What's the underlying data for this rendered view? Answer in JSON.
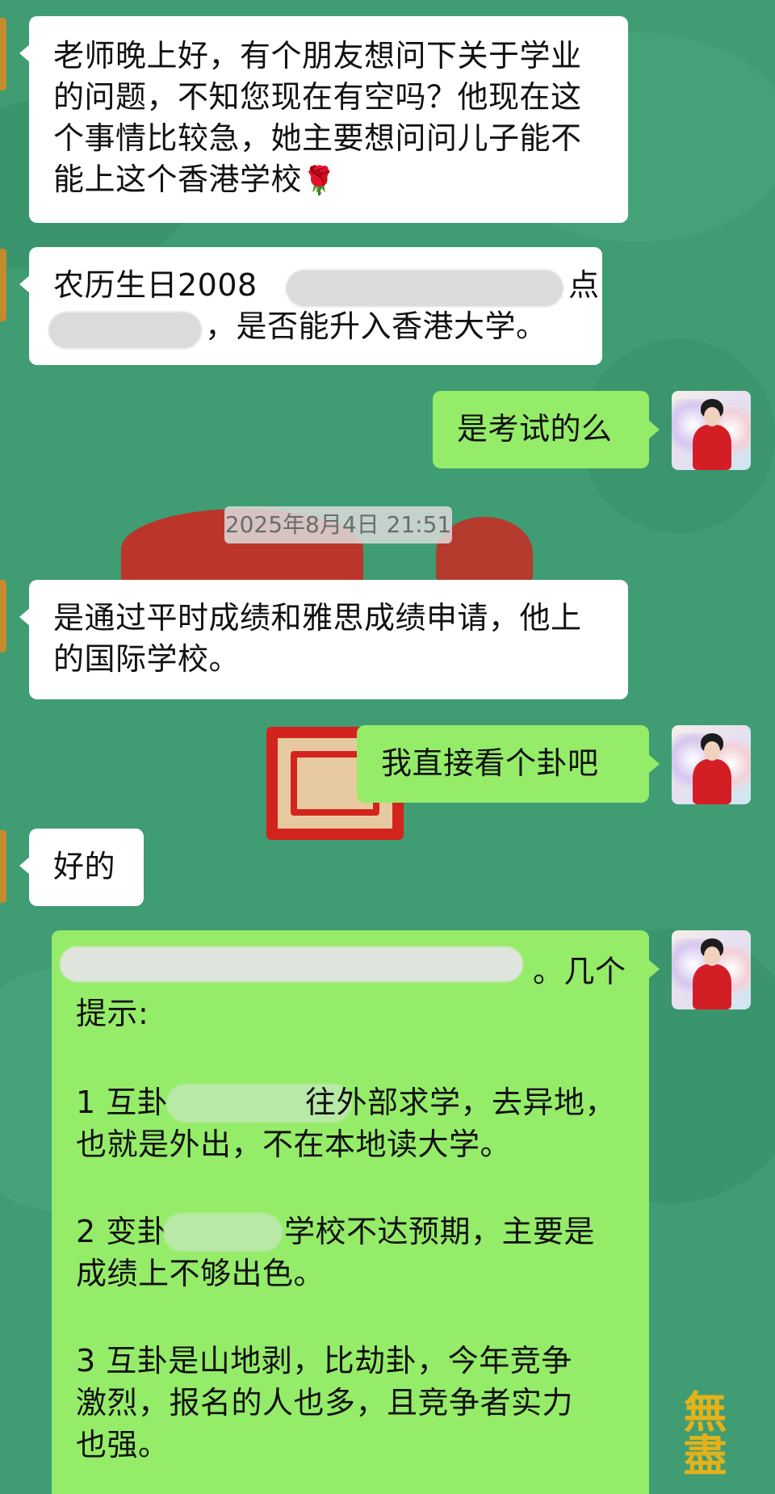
{
  "chat": {
    "timestamp": "2025年8月4日 21:51",
    "messages": [
      {
        "side": "left",
        "text": "老师晚上好，有个朋友想问下关于学业的问题，不知您现在有空吗？他现在这个事情比较急，她主要想问问儿子能不能上这个香港学校",
        "emoji": "🌹"
      },
      {
        "side": "left",
        "line1": "农历生日2008",
        "line1_end": "点",
        "line2": "，是否能升入香港大学。"
      },
      {
        "side": "right",
        "text": "是考试的么"
      },
      {
        "side": "left",
        "text": "是通过平时成绩和雅思成绩申请，他上的国际学校。"
      },
      {
        "side": "right",
        "text": "我直接看个卦吧"
      },
      {
        "side": "left",
        "text": "好的"
      },
      {
        "side": "right",
        "line1_end": "。几个",
        "line2": "提示:",
        "p1_start": "1 互卦",
        "p1_mid": "往外部求学，去异地，",
        "p1_line2": "也就是外出，不在本地读大学。",
        "p2_start": "2 变卦",
        "p2_mid": "学校不达预期，主要是",
        "p2_line2": "成绩上不够出色。",
        "p3_line1": "3 互卦是山地剥，比劫卦，今年竞争",
        "p3_line2": "激烈，报名的人也多，且竞争者实力",
        "p3_line3": "也强。"
      }
    ]
  },
  "wallpaper": {
    "calligraphy": "無盡"
  },
  "colors": {
    "background": "#3f9c73",
    "left_bubble": "#ffffff",
    "right_bubble": "#95ec69",
    "accent_red": "#d2231d"
  }
}
